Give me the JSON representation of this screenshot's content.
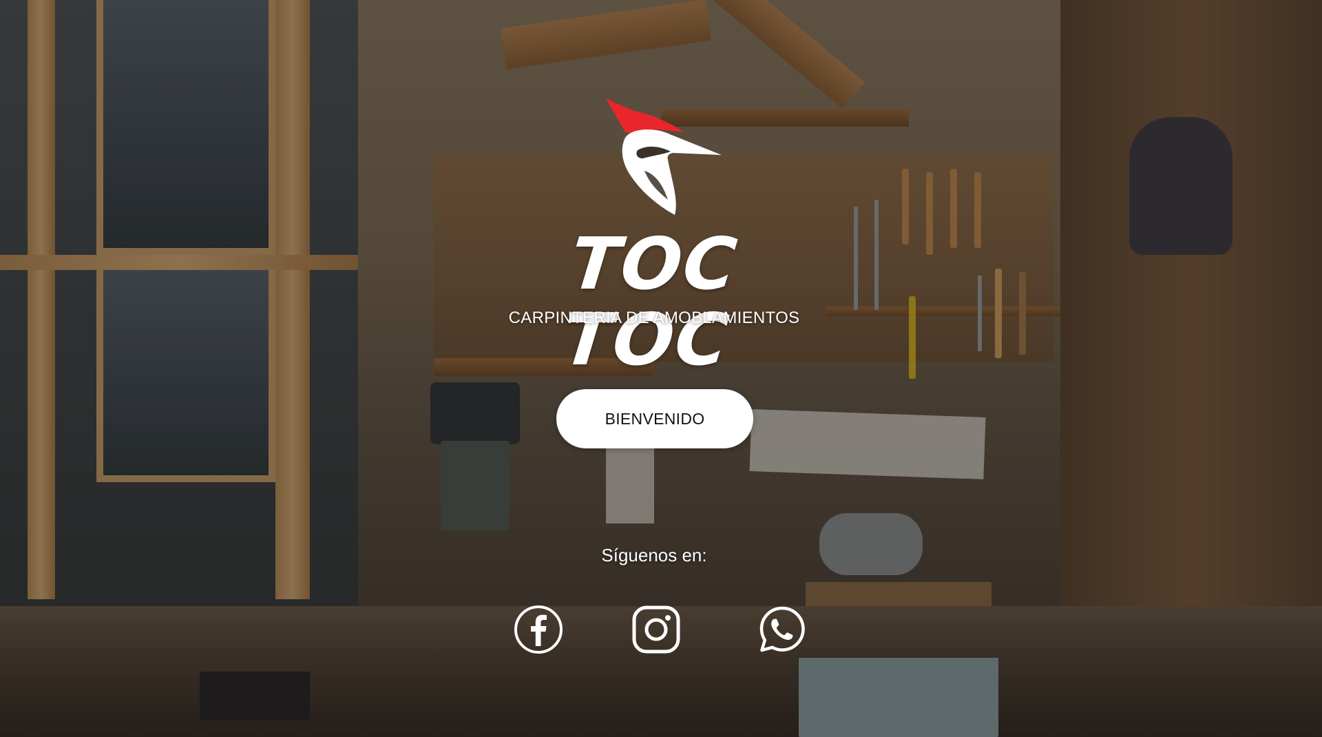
{
  "brand": {
    "name": "TOC TOC",
    "tagline": "CARPINTERIA DE AMOBLAMIENTOS",
    "accent_color": "#e8262b",
    "logo_icon": "woodpecker-icon"
  },
  "hero": {
    "welcome_button_label": "BIENVENIDO"
  },
  "social": {
    "label": "Síguenos en:",
    "links": [
      {
        "name": "Facebook",
        "icon": "facebook-icon"
      },
      {
        "name": "Instagram",
        "icon": "instagram-icon"
      },
      {
        "name": "WhatsApp",
        "icon": "whatsapp-icon"
      }
    ]
  },
  "background": {
    "subject": "woodworking workshop photo",
    "overlay_color": "#141008"
  }
}
